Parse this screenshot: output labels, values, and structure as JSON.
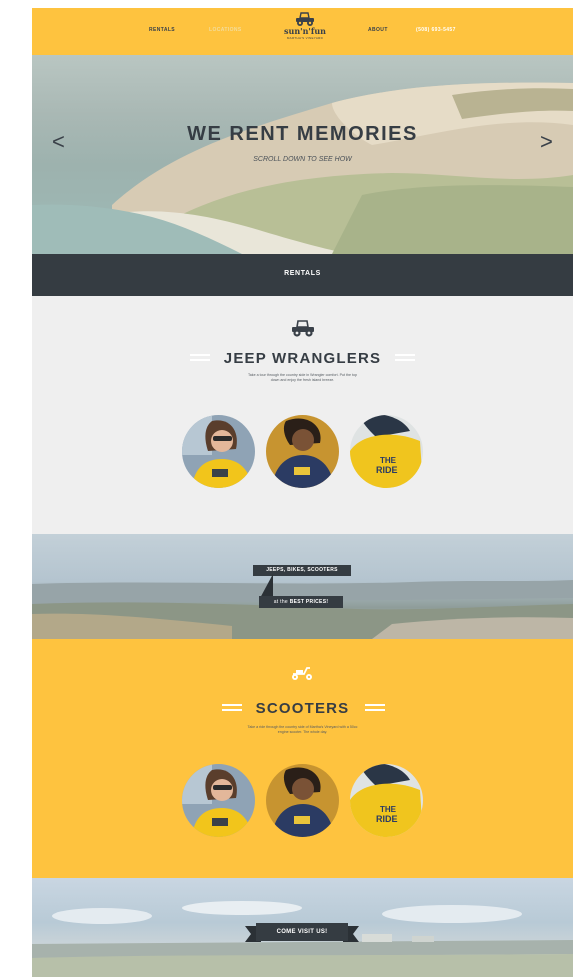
{
  "header": {
    "nav_left": [
      "RENTALS",
      "LOCATIONS"
    ],
    "logo_name": "sun'n'fun",
    "logo_tagline": "MARTHA'S VINEYARD",
    "nav_right": [
      "ABOUT",
      "(508) 693-5457"
    ]
  },
  "hero": {
    "title": "WE RENT MEMORIES",
    "subtitle": "SCROLL DOWN TO SEE HOW",
    "prev_arrow": "<",
    "next_arrow": ">"
  },
  "rentals_bar": {
    "label": "RENTALS"
  },
  "jeeps": {
    "icon": "jeep-icon",
    "title": "JEEP WRANGLERS",
    "description": "Take a tour through the country side in Wrangler comfort. Put the top down and enjoy the fresh island breeze.",
    "photos": [
      "photo-woman-yellow-shirt",
      "photo-man-navy-shirt",
      "photo-back-yellow-shirt"
    ]
  },
  "banner_deals": {
    "ribbon_top": "JEEPS, BIKES, SCOOTERS",
    "ribbon_bottom_prefix": "at the ",
    "ribbon_bottom_emphasis": "BEST PRICES!"
  },
  "scooters": {
    "icon": "scooter-icon",
    "title": "SCOOTERS",
    "description": "Take a ride through the country side of Martha's Vineyard with a 50cc engine scooter. The whole day.",
    "photos": [
      "photo-woman-yellow-shirt",
      "photo-man-navy-shirt",
      "photo-back-yellow-shirt"
    ]
  },
  "banner_visit": {
    "ribbon": "COME VISIT US!"
  },
  "colors": {
    "yellow": "#fec33f",
    "charcoal": "#353c42",
    "light_gray": "#efefef"
  }
}
